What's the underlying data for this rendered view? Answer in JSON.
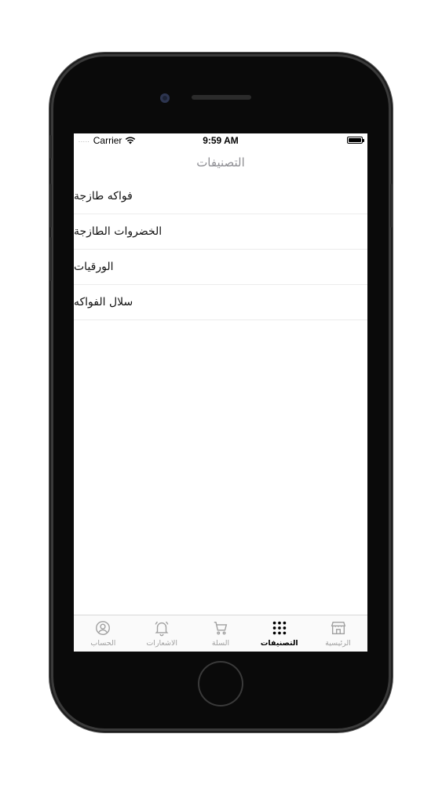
{
  "status_bar": {
    "carrier": "Carrier",
    "time": "9:59 AM",
    "signal_dots": "....."
  },
  "nav": {
    "title": "التصنيفات"
  },
  "categories": [
    {
      "label": "فواكه طازجة"
    },
    {
      "label": "الخضروات الطازجة"
    },
    {
      "label": "الورقيات"
    },
    {
      "label": "سلال الفواكه"
    }
  ],
  "tab_bar": {
    "tabs": [
      {
        "label": "الحساب",
        "icon": "profile-icon",
        "active": false
      },
      {
        "label": "الاشعارات",
        "icon": "bell-icon",
        "active": false
      },
      {
        "label": "السلة",
        "icon": "cart-icon",
        "active": false
      },
      {
        "label": "التصنيفات",
        "icon": "grid-icon",
        "active": true
      },
      {
        "label": "الرئيسية",
        "icon": "store-icon",
        "active": false
      }
    ],
    "active_color": "#000000",
    "inactive_color": "#a0a0a0"
  }
}
